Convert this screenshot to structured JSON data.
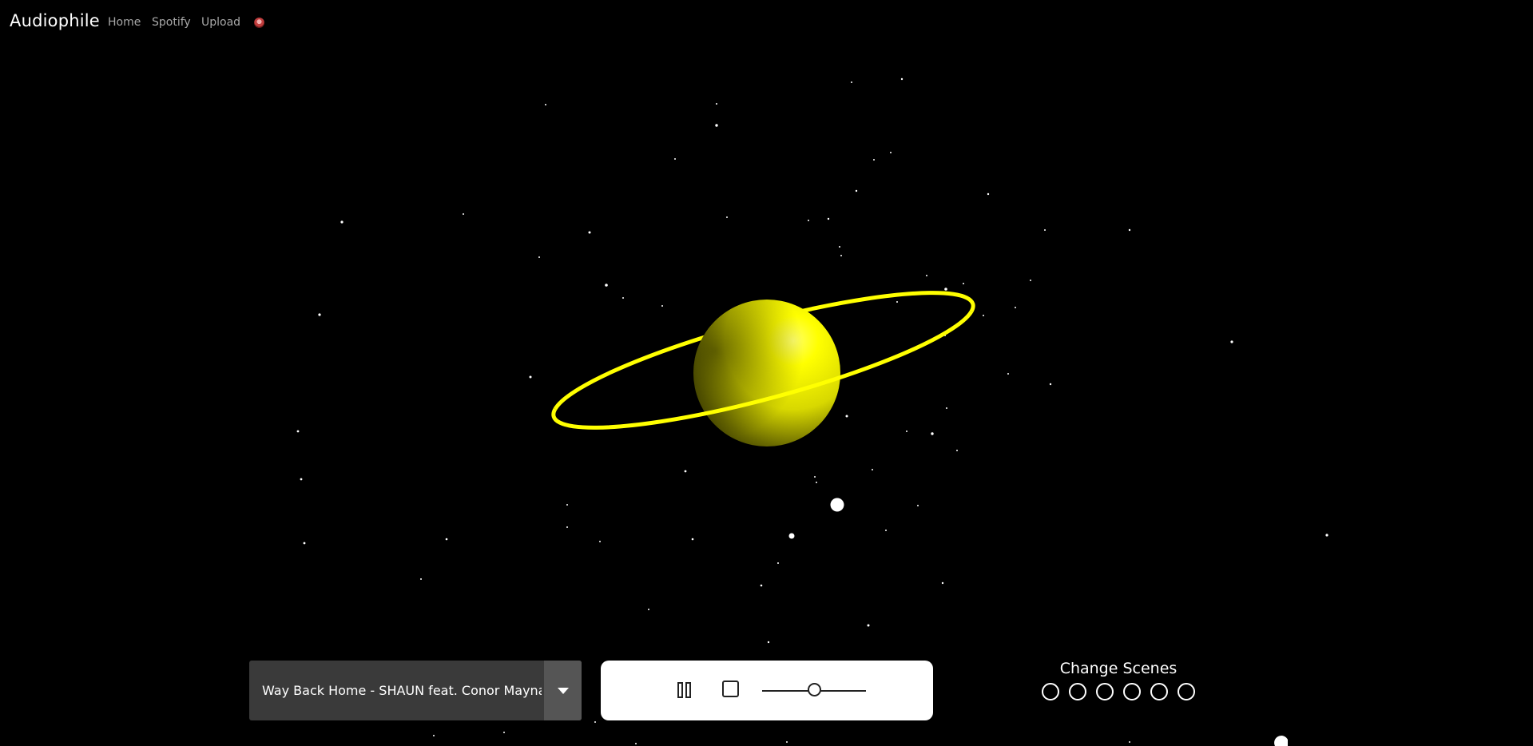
{
  "navbar": {
    "brand": "Audiophile",
    "links": [
      "Home",
      "Spotify",
      "Upload"
    ],
    "avatar_icon": "user-avatar-icon"
  },
  "player": {
    "current_song": "Way Back Home - SHAUN feat. Conor Maynard",
    "pause_icon": "pause-icon",
    "stop_icon": "stop-icon",
    "volume_level": 0.5
  },
  "scenes": {
    "title": "Change Scenes",
    "count": 6
  },
  "colors": {
    "background": "#000000",
    "planet": "#ffff00",
    "ring": "#ffff00",
    "stars": "#ffffff",
    "nav_link": "#a8a8a8",
    "select_bg": "#3a3a3a",
    "select_arrow_bg": "#555555",
    "player_bg": "#ffffff"
  }
}
